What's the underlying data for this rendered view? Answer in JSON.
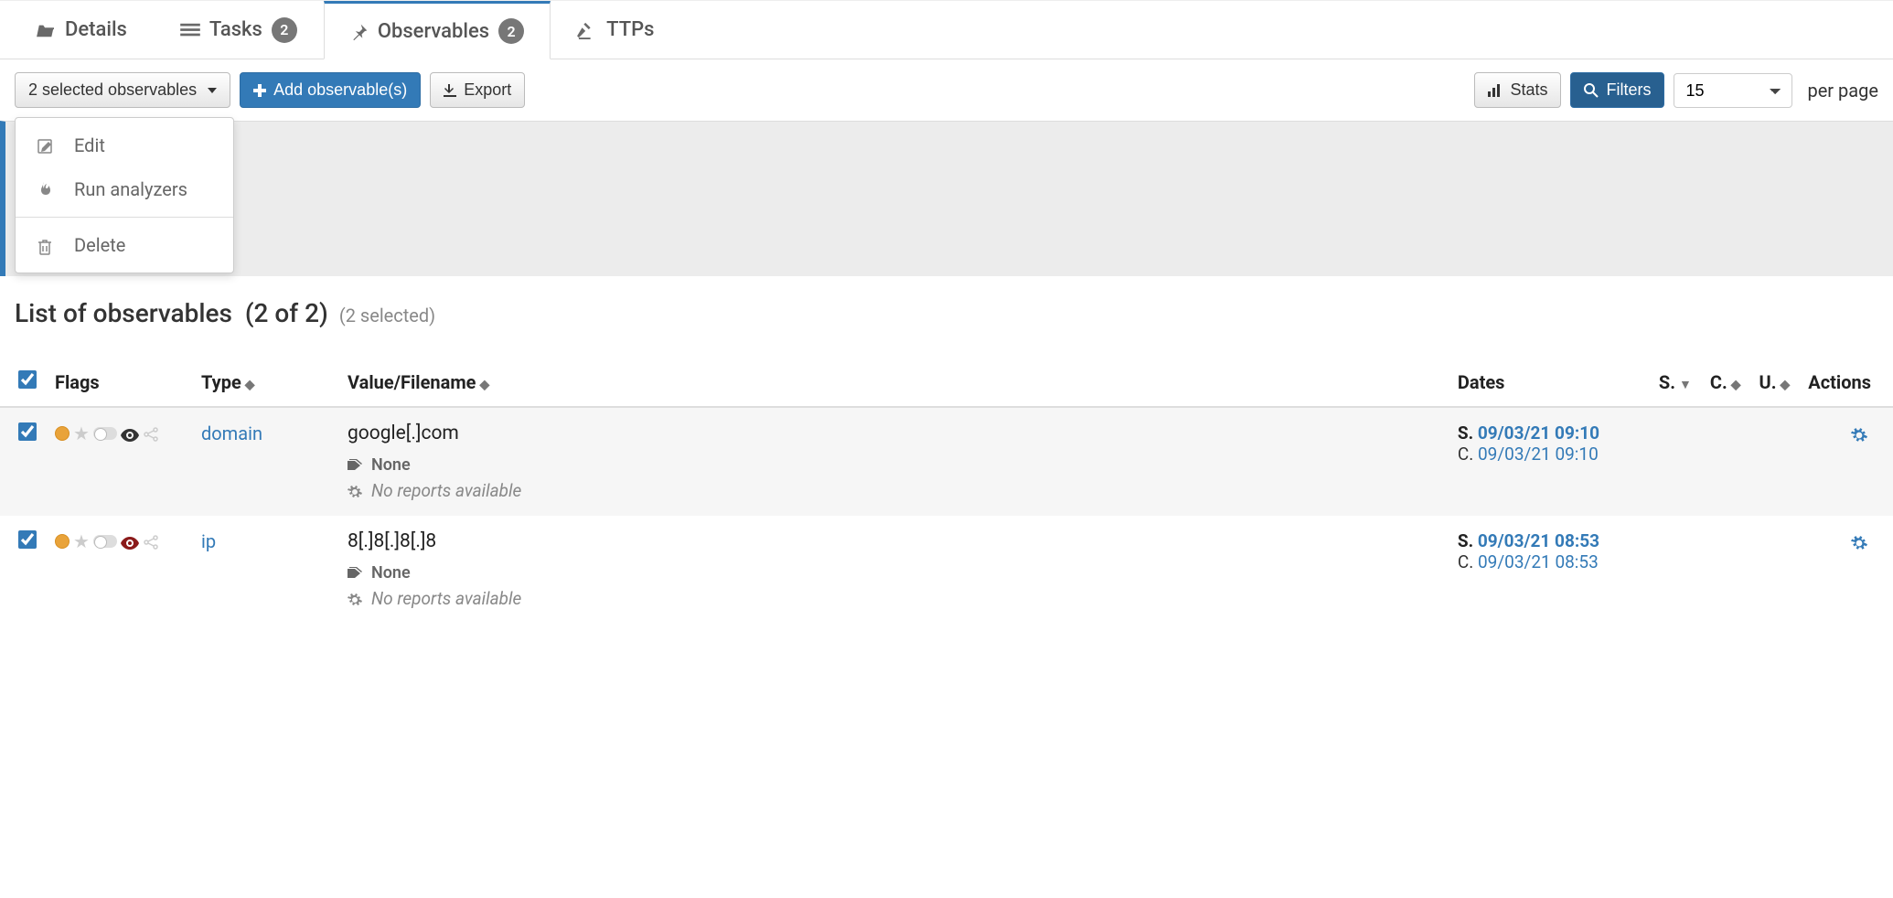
{
  "tabs": {
    "details": "Details",
    "tasks": "Tasks",
    "tasks_count": "2",
    "observables": "Observables",
    "observables_count": "2",
    "ttps": "TTPs"
  },
  "toolbar": {
    "selected_label": "2 selected observables",
    "add": "Add observable(s)",
    "export": "Export",
    "stats": "Stats",
    "filters": "Filters",
    "per_page_value": "15",
    "per_page_label": "per page"
  },
  "dropdown": {
    "edit": "Edit",
    "run_analyzers": "Run analyzers",
    "delete": "Delete"
  },
  "heading": {
    "title": "List of observables",
    "count": "(2 of 2)",
    "selected": "(2 selected)"
  },
  "columns": {
    "flags": "Flags",
    "type": "Type",
    "value": "Value/Filename",
    "dates": "Dates",
    "s": "S.",
    "c": "C.",
    "u": "U.",
    "actions": "Actions"
  },
  "rows": [
    {
      "type": "domain",
      "value": "google[.]com",
      "tags": "None",
      "reports": "No reports available",
      "s_date": "09/03/21 09:10",
      "c_date": "09/03/21 09:10",
      "eye_red": false
    },
    {
      "type": "ip",
      "value": "8[.]8[.]8[.]8",
      "tags": "None",
      "reports": "No reports available",
      "s_date": "09/03/21 08:53",
      "c_date": "09/03/21 08:53",
      "eye_red": true
    }
  ],
  "labels": {
    "s_prefix": "S.",
    "c_prefix": "C."
  }
}
